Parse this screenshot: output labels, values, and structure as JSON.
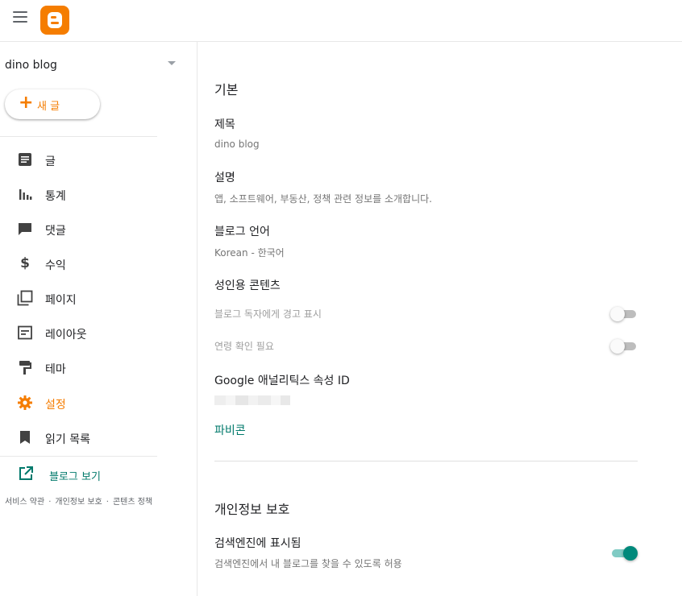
{
  "header": {
    "menu_icon": "hamburger-menu-icon",
    "logo_icon": "blogger-logo-icon",
    "brand_color": "#f57d00"
  },
  "sidebar": {
    "blog_name": "dino blog",
    "new_post_label": "새 글",
    "items": [
      {
        "label": "글",
        "icon": "posts-icon"
      },
      {
        "label": "통계",
        "icon": "stats-icon"
      },
      {
        "label": "댓글",
        "icon": "comments-icon"
      },
      {
        "label": "수익",
        "icon": "dollar-icon"
      },
      {
        "label": "페이지",
        "icon": "pages-icon"
      },
      {
        "label": "레이아웃",
        "icon": "layout-icon"
      },
      {
        "label": "테마",
        "icon": "theme-icon"
      },
      {
        "label": "설정",
        "icon": "settings-gear-icon",
        "active": true
      },
      {
        "label": "읽기 목록",
        "icon": "bookmark-icon"
      }
    ],
    "view_blog_label": "블로그 보기",
    "footer": {
      "terms": "서비스 약관",
      "privacy": "개인정보 보호",
      "content_policy": "콘텐츠 정책",
      "separator": "·"
    }
  },
  "main": {
    "basic": {
      "section_title": "기본",
      "title_label": "제목",
      "title_value": "dino blog",
      "description_label": "설명",
      "description_value": "앱, 소프트웨어, 부동산, 정책 관련 정보를 소개합니다.",
      "language_label": "블로그 언어",
      "language_value": "Korean - 한국어",
      "adult_label": "성인용 콘텐츠",
      "adult_warning_label": "블로그 독자에게 경고 표시",
      "adult_warning_on": false,
      "age_verify_label": "연령 확인 필요",
      "age_verify_on": false,
      "ga_label": "Google 애널리틱스 속성 ID",
      "favicon_label": "파비콘"
    },
    "privacy": {
      "section_title": "개인정보 보호",
      "search_visible_label": "검색엔진에 표시됨",
      "search_visible_desc": "검색엔진에서 내 블로그를 찾을 수 있도록 허용",
      "search_visible_on": true
    }
  },
  "colors": {
    "accent_orange": "#f57d00",
    "accent_teal": "#00796b",
    "toggle_on": "#00897b"
  }
}
